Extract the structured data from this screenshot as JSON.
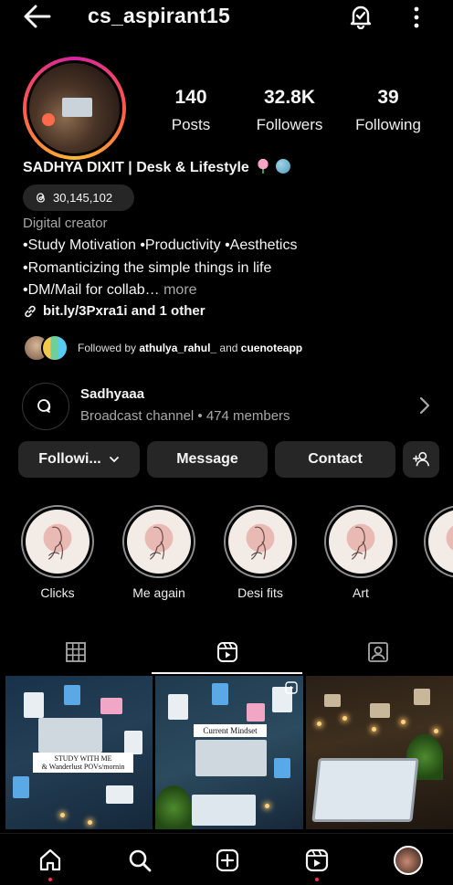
{
  "header": {
    "username": "cs_aspirant15"
  },
  "profile": {
    "display_name": "SADHYA DIXIT | Desk & Lifestyle",
    "threads_count": "30,145,102",
    "category": "Digital creator",
    "bio": [
      "•Study Motivation •Productivity •Aesthetics",
      "•Romanticizing the simple things in life",
      "•DM/Mail for collab…"
    ],
    "more_label": "more",
    "link_text": "bit.ly/3Pxra1i and 1 other",
    "followed_by_prefix": "Followed by",
    "followed_by_user1": "athulya_rahul_",
    "followed_by_and": "and",
    "followed_by_user2": "cuenoteapp"
  },
  "stats": [
    {
      "value": "140",
      "label": "Posts"
    },
    {
      "value": "32.8K",
      "label": "Followers"
    },
    {
      "value": "39",
      "label": "Following"
    }
  ],
  "channel": {
    "title": "Sadhyaaa",
    "subtitle": "Broadcast channel • 474 members"
  },
  "actions": {
    "following": "Followi...",
    "message": "Message",
    "contact": "Contact"
  },
  "highlights": [
    {
      "label": "Clicks"
    },
    {
      "label": "Me again"
    },
    {
      "label": "Desi fits"
    },
    {
      "label": "Art"
    }
  ],
  "posts": {
    "p1_overlay_line1": "STUDY WITH ME",
    "p1_overlay_line2": "& Wanderlust POVs/mornin",
    "p2_overlay": "Current Mindset"
  },
  "colors": {
    "background": "#000000",
    "button_bg": "#262626",
    "muted_text": "#a8a8a8",
    "notification_dot": "#ff3040"
  },
  "icons": [
    "back-arrow-icon",
    "bell-check-icon",
    "more-vertical-icon",
    "threads-icon",
    "link-icon",
    "broadcast-channel-icon",
    "chevron-right-icon",
    "chevron-down-icon",
    "add-person-icon",
    "grid-icon",
    "reels-icon",
    "tagged-icon",
    "home-icon",
    "search-icon",
    "create-icon",
    "reels-nav-icon"
  ]
}
